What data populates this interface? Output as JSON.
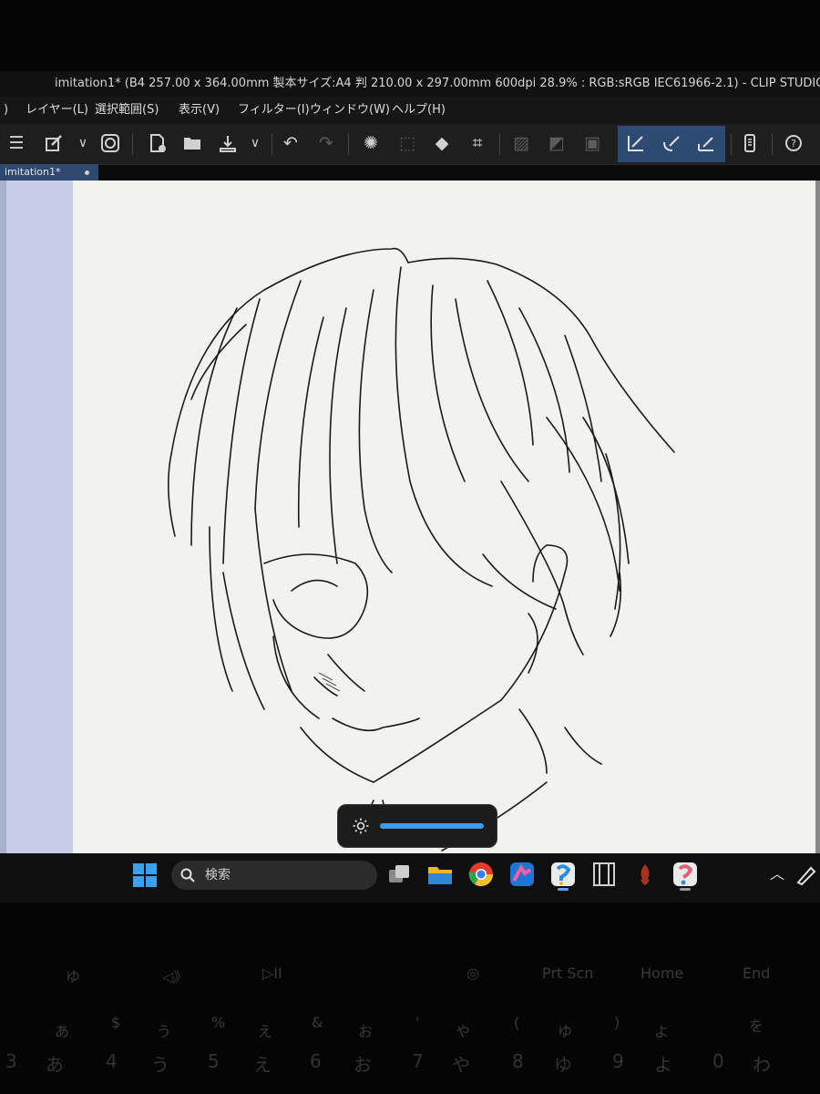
{
  "window": {
    "title": "imitation1* (B4 257.00 x 364.00mm 製本サイズ:A4 判 210.00 x 297.00mm 600dpi 28.9% : RGB:sRGB IEC61966-2.1)  - CLIP STUDIO PAINT PRO"
  },
  "menu": [
    {
      "label": "レイヤー(L)"
    },
    {
      "label": "選択範囲(S)"
    },
    {
      "label": "表示(V)"
    },
    {
      "label": "フィルター(I)"
    },
    {
      "label": "ウィンドウ(W)"
    },
    {
      "label": "ヘルプ(H)"
    }
  ],
  "toolbar_icons": [
    "menu-icon",
    "edit-layer-icon",
    "chevron-down-icon",
    "clip-studio-icon",
    "new-file-icon",
    "open-folder-icon",
    "save-icon",
    "chevron-down-icon",
    "undo-icon",
    "redo-icon",
    "loading-icon",
    "clear-selection-icon",
    "fill-icon",
    "transform-icon",
    "hide-selection-icon",
    "fill-transparent-icon",
    "select-all-icon",
    "snap-ruler-icon",
    "snap-special-ruler-icon",
    "snap-grid-icon",
    "smartphone-icon",
    "help-icon"
  ],
  "tab": {
    "label": "imitation1*"
  },
  "taskbar": {
    "search_label": "検索",
    "icons": [
      "windows-start-icon",
      "search-icon",
      "task-view-icon",
      "file-explorer-icon",
      "chrome-icon",
      "paint-app-icon",
      "clip-studio-paint-icon",
      "film-icon",
      "campfire-icon",
      "clip-studio-icon",
      "chevron-up-icon",
      "pen-icon"
    ]
  },
  "brightness": {
    "icon": "sun-icon",
    "level": 1.0
  },
  "keyboard": {
    "fn_row": [
      "ゆ",
      "◁》",
      "▷II",
      "◎",
      "Prt Scn",
      "Home",
      "End"
    ],
    "upper_row": [
      "あ",
      "$",
      "う",
      "%",
      "え",
      "&",
      "お",
      "'",
      "や",
      "(",
      "ゆ",
      ")",
      "よ",
      "を"
    ],
    "lower_row": [
      "3",
      "あ",
      "4",
      "う",
      "5",
      "え",
      "6",
      "お",
      "7",
      "や",
      "8",
      "ゆ",
      "9",
      "よ",
      "0",
      "わ"
    ]
  }
}
